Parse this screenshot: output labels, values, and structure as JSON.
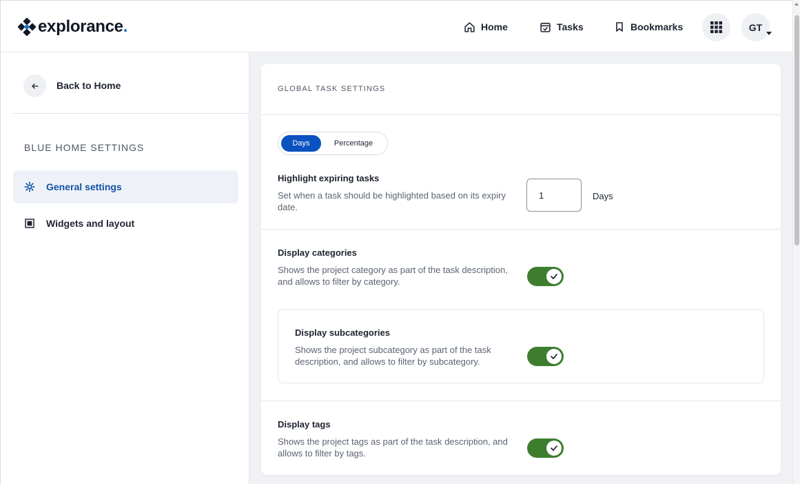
{
  "header": {
    "brand": "explorance",
    "brand_dot": ".",
    "nav": [
      {
        "label": "Home",
        "icon": "home-icon"
      },
      {
        "label": "Tasks",
        "icon": "tasks-icon"
      },
      {
        "label": "Bookmarks",
        "icon": "bookmark-icon"
      }
    ],
    "apps_icon": "apps-grid-icon",
    "avatar_initials": "GT"
  },
  "sidebar": {
    "back_label": "Back to Home",
    "section_title": "BLUE HOME SETTINGS",
    "items": [
      {
        "label": "General settings",
        "icon": "gear-icon",
        "active": true
      },
      {
        "label": "Widgets and layout",
        "icon": "layout-grid-icon",
        "active": false
      }
    ]
  },
  "main": {
    "card_title": "GLOBAL TASK SETTINGS",
    "segment": {
      "options": [
        "Days",
        "Percentage"
      ],
      "selected": "Days"
    },
    "highlight": {
      "title": "Highlight expiring tasks",
      "desc": "Set when a task should be highlighted based on its expiry date.",
      "value": "1",
      "unit": "Days"
    },
    "categories": {
      "title": "Display categories",
      "desc": "Shows the project category as part of the task description, and allows to filter by category.",
      "enabled": true
    },
    "subcategories": {
      "title": "Display subcategories",
      "desc": "Shows the project subcategory as part of the task description, and allows to filter by subcategory.",
      "enabled": true
    },
    "tags": {
      "title": "Display tags",
      "desc": "Shows the project tags as part of the task description, and allows to filter by tags.",
      "enabled": true
    }
  },
  "colors": {
    "accent": "#0b52c1",
    "toggle_on": "#3e7d2e",
    "active_nav_text": "#1452a6"
  }
}
